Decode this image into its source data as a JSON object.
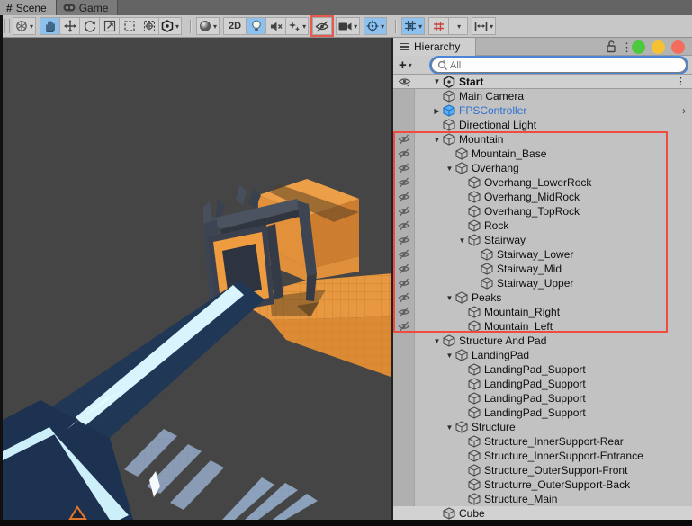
{
  "view_tabs": [
    {
      "label": "Scene"
    },
    {
      "label": "Game"
    }
  ],
  "toolbar": {
    "label_2d": "2D",
    "tools": [
      "view-gizmo",
      "hand-tool",
      "move-tool",
      "rotate-tool",
      "scale-tool",
      "rect-tool",
      "transform-tool",
      "unity-menu",
      "shading-mode",
      "2d-toggle",
      "lighting-toggle",
      "audio-mute",
      "effects-menu",
      "scene-visibility",
      "camera-menu",
      "gizmos-toggle",
      "grid-snap",
      "snap-grid-axis",
      "snap-increment"
    ]
  },
  "icons": {
    "expanded": "▼",
    "collapsed": "▶",
    "dropdown": "▾",
    "more": "⋮",
    "chevron": "›",
    "plus": "+"
  },
  "hierarchy": {
    "tab_label": "Hierarchy",
    "search_placeholder": "All",
    "scene": {
      "label": "Start"
    },
    "items": [
      {
        "label": "Main Camera",
        "depth": 1,
        "twisty": "",
        "icon": "cube"
      },
      {
        "label": "FPSController",
        "depth": 1,
        "twisty": "collapsed",
        "icon": "prefab-cube",
        "blue": true,
        "trailing": "chevron"
      },
      {
        "label": "Directional Light",
        "depth": 1,
        "twisty": "",
        "icon": "cube"
      },
      {
        "label": "Mountain",
        "depth": 1,
        "twisty": "expanded",
        "icon": "cube",
        "eye": "hidden"
      },
      {
        "label": "Mountain_Base",
        "depth": 2,
        "twisty": "",
        "icon": "cube",
        "eye": "hidden"
      },
      {
        "label": "Overhang",
        "depth": 2,
        "twisty": "expanded",
        "icon": "cube",
        "eye": "hidden"
      },
      {
        "label": "Overhang_LowerRock",
        "depth": 3,
        "twisty": "",
        "icon": "cube",
        "eye": "hidden"
      },
      {
        "label": "Overhang_MidRock",
        "depth": 3,
        "twisty": "",
        "icon": "cube",
        "eye": "hidden"
      },
      {
        "label": "Overhang_TopRock",
        "depth": 3,
        "twisty": "",
        "icon": "cube",
        "eye": "hidden"
      },
      {
        "label": "Rock",
        "depth": 3,
        "twisty": "",
        "icon": "cube",
        "eye": "hidden"
      },
      {
        "label": "Stairway",
        "depth": 3,
        "twisty": "expanded",
        "icon": "cube",
        "eye": "hidden"
      },
      {
        "label": "Stairway_Lower",
        "depth": 4,
        "twisty": "",
        "icon": "cube",
        "eye": "hidden"
      },
      {
        "label": "Stairway_Mid",
        "depth": 4,
        "twisty": "",
        "icon": "cube",
        "eye": "hidden"
      },
      {
        "label": "Stairway_Upper",
        "depth": 4,
        "twisty": "",
        "icon": "cube",
        "eye": "hidden"
      },
      {
        "label": "Peaks",
        "depth": 2,
        "twisty": "expanded",
        "icon": "cube",
        "eye": "hidden"
      },
      {
        "label": "Mountain_Right",
        "depth": 3,
        "twisty": "",
        "icon": "cube",
        "eye": "hidden"
      },
      {
        "label": "Mountain_Left",
        "depth": 3,
        "twisty": "",
        "icon": "cube",
        "eye": "hidden"
      },
      {
        "label": "Structure And Pad",
        "depth": 1,
        "twisty": "expanded",
        "icon": "cube"
      },
      {
        "label": "LandingPad",
        "depth": 2,
        "twisty": "expanded",
        "icon": "cube"
      },
      {
        "label": "LandingPad_Support",
        "depth": 3,
        "twisty": "",
        "icon": "cube"
      },
      {
        "label": "LandingPad_Support",
        "depth": 3,
        "twisty": "",
        "icon": "cube"
      },
      {
        "label": "LandingPad_Support",
        "depth": 3,
        "twisty": "",
        "icon": "cube"
      },
      {
        "label": "LandingPad_Support",
        "depth": 3,
        "twisty": "",
        "icon": "cube"
      },
      {
        "label": "Structure",
        "depth": 2,
        "twisty": "expanded",
        "icon": "cube"
      },
      {
        "label": "Structure_InnerSupport-Rear",
        "depth": 3,
        "twisty": "",
        "icon": "cube"
      },
      {
        "label": "Structure_InnerSupport-Entrance",
        "depth": 3,
        "twisty": "",
        "icon": "cube"
      },
      {
        "label": "Structure_OuterSupport-Front",
        "depth": 3,
        "twisty": "",
        "icon": "cube"
      },
      {
        "label": "Structurre_OuterSupport-Back",
        "depth": 3,
        "twisty": "",
        "icon": "cube"
      },
      {
        "label": "Structure_Main",
        "depth": 3,
        "twisty": "",
        "icon": "cube"
      },
      {
        "label": "Cube",
        "depth": 1,
        "twisty": "",
        "icon": "cube",
        "highlight": true
      }
    ]
  },
  "colors": {
    "highlight_red": "#f14b40",
    "selection_blue": "#8fc1ee",
    "prefab_blue": "#2f6fd0",
    "focus_ring": "#4a86d8",
    "scene_bg": "#454545",
    "terrain_orange": "#e8953f",
    "structure_navy": "#1d3150",
    "trim_cyan": "#d7f3fb",
    "support_grey": "#8fa3bf",
    "traffic_green": "#4cc93f",
    "traffic_yellow": "#f5c132",
    "traffic_red": "#f36d5d"
  }
}
